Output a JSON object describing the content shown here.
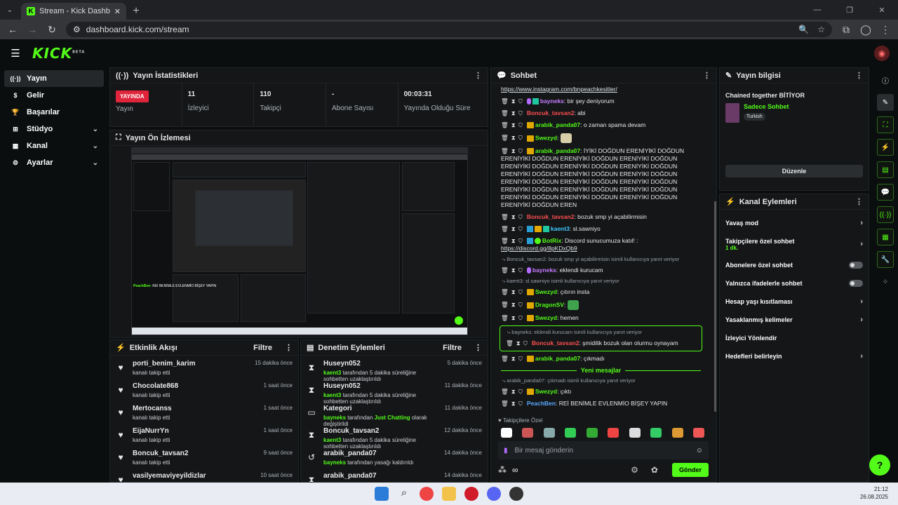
{
  "browser": {
    "tab_title": "Stream - Kick Dashboard",
    "url": "dashboard.kick.com/stream"
  },
  "brand": {
    "logo": "KICK",
    "beta": "BETA",
    "accent": "#53fc18"
  },
  "sidebar": {
    "items": [
      {
        "label": "Yayın",
        "icon": "broadcast-icon",
        "active": true
      },
      {
        "label": "Gelir",
        "icon": "dollar-icon"
      },
      {
        "label": "Başarılar",
        "icon": "trophy-icon"
      },
      {
        "label": "Stüdyo",
        "icon": "studio-icon",
        "chevron": true
      },
      {
        "label": "Kanal",
        "icon": "kanal-icon",
        "chevron": true
      },
      {
        "label": "Ayarlar",
        "icon": "gear-icon",
        "chevron": true
      }
    ]
  },
  "stats": {
    "title": "Yayın İstatistikleri",
    "live_badge": "YAYINDA",
    "live_label": "Yayın",
    "items": [
      {
        "value": "11",
        "label": "İzleyici"
      },
      {
        "value": "110",
        "label": "Takipçi"
      },
      {
        "value": "-",
        "label": "Abone Sayısı"
      },
      {
        "value": "00:03:31",
        "label": "Yayında Olduğu Süre"
      }
    ]
  },
  "preview": {
    "title": "Yayın Ön İzlemesi",
    "overlay_name": "PeachBen:",
    "overlay_text": "REİ BENİMLE EVLENMİO BİŞEY YAPIN"
  },
  "activity": {
    "title": "Etkinlik Akışı",
    "filter": "Filtre",
    "items": [
      {
        "name": "porti_benim_karim",
        "sub": "kanalı takip etti",
        "time": "15 dakika önce"
      },
      {
        "name": "Chocolate868",
        "sub": "kanalı takip etti",
        "time": "1 saat önce"
      },
      {
        "name": "Mertocanss",
        "sub": "kanalı takip etti",
        "time": "1 saat önce"
      },
      {
        "name": "EijaNurrYn",
        "sub": "kanalı takip etti",
        "time": "1 saat önce"
      },
      {
        "name": "Boncuk_tavsan2",
        "sub": "kanalı takip etti",
        "time": "9 saat önce"
      },
      {
        "name": "vasilyemaviyeyildizlar",
        "sub": "",
        "time": "10 saat önce"
      }
    ]
  },
  "mod": {
    "title": "Denetim Eylemleri",
    "filter": "Filtre",
    "items": [
      {
        "name": "Huseyn052",
        "actor": "kaent3",
        "rest": " tarafından 5 dakika süreliğine sohbetten uzaklaştırıldı",
        "time": "5 dakika önce",
        "icon": "hourglass-icon"
      },
      {
        "name": "Huseyn052",
        "actor": "kaent3",
        "rest": " tarafından 5 dakika süreliğine sohbetten uzaklaştırıldı",
        "time": "11 dakika önce",
        "icon": "hourglass-icon"
      },
      {
        "name": "Kategori",
        "actor": "bayneks",
        "mid": " tarafından ",
        "hl": "Just Chatting",
        "rest": " olarak değiştirildi",
        "time": "11 dakika önce",
        "icon": "category-icon"
      },
      {
        "name": "Boncuk_tavsan2",
        "actor": "kaent3",
        "rest": " tarafından 5 dakika süreliğine sohbetten uzaklaştırıldı",
        "time": "12 dakika önce",
        "icon": "hourglass-icon"
      },
      {
        "name": "arabik_panda07",
        "actor": "bayneks",
        "rest": " tarafından yasağı kaldırıldı",
        "time": "14 dakika önce",
        "icon": "undo-icon"
      },
      {
        "name": "arabik_panda07",
        "actor": "",
        "rest": "",
        "time": "14 dakika önce",
        "icon": "hourglass-icon"
      }
    ]
  },
  "chat": {
    "title": "Sohbet",
    "top_link": "https://www.instagram.com/bnpeachkesitler/",
    "messages": [
      {
        "user": "bayneks",
        "cls": "u-p",
        "badges": [
          "purple",
          "teal"
        ],
        "text": "bir şey deniyorum"
      },
      {
        "user": "Boncuk_tavsan2",
        "cls": "u-r",
        "badges": [],
        "text": "abi"
      },
      {
        "user": "arabik_panda07",
        "cls": "u-y",
        "badges": [
          "crown"
        ],
        "text": "o zaman spama devam"
      },
      {
        "user": "Swezyd",
        "cls": "u-y",
        "badges": [
          "crown"
        ],
        "text": "",
        "emote": "#d8cfa8"
      },
      {
        "user": "arabik_panda07",
        "cls": "u-y",
        "badges": [
          "crown"
        ],
        "text": "İYİKİ DOĞDUN ERENİYİKİ DOĞDUN ERENİYİKİ DOĞDUN ERENİYİKİ DOĞDUN ERENİYİKİ DOĞDUN ERENİYİKİ DOĞDUN ERENİYİKİ DOĞDUN ERENİYİKİ DOĞDUN ERENİYİKİ DOĞDUN ERENİYİKİ DOĞDUN ERENİYİKİ DOĞDUN ERENİYİKİ DOĞDUN ERENİYİKİ DOĞDUN ERENİYİKİ DOĞDUN ERENİYİKİ DOĞDUN ERENİYİKİ DOĞDUN ERENİYİKİ DOĞDUN ERENİYİKİ DOĞDUN ERENİYİKİ DOĞDUN ERENİYİKİ DOĞDUN ERENİYİKİ DOĞDUN EREN"
      },
      {
        "user": "Boncuk_tavsan2",
        "cls": "u-r",
        "badges": [],
        "text": "bozuk smp yi açabilirmisin"
      },
      {
        "user": "kaent3",
        "cls": "u-c",
        "badges": [
          "blue",
          "crown",
          "teal"
        ],
        "text": "sl.sawniyo"
      },
      {
        "user": "BotRix",
        "cls": "u-y",
        "badges": [
          "blue",
          "gcheck"
        ],
        "text": "Discord sunucumuza katıl! :",
        "link": "https://discord.gg/8pKDxQb9"
      },
      {
        "reply": "Boncuk_tavsan2: bozuk smp yi açabilirmisin isimli kullanıcıya yanıt veriyor",
        "user": "bayneks",
        "cls": "u-p",
        "badges": [
          "purple"
        ],
        "text": "eklendi kurucam"
      },
      {
        "reply": "kaent3: sl.sawniyo isimli kullanıcıya yanıt veriyor",
        "user": "Swezyd",
        "cls": "u-y",
        "badges": [
          "crown"
        ],
        "text": "çıtırın insta"
      },
      {
        "user": "DragonSV",
        "cls": "u-y",
        "badges": [
          "crown"
        ],
        "text": "",
        "emote": "#3fa34d"
      },
      {
        "user": "Swezyd",
        "cls": "u-y",
        "badges": [
          "crown"
        ],
        "text": "hemen"
      },
      {
        "highlight": true,
        "reply": "bayneks: eklendi kurucam isimli kullanıcıya yanıt veriyor",
        "user": "Boncuk_tavsan2",
        "cls": "u-r",
        "badges": [],
        "text": "şmidilik bozuk olan olurmu oynayam"
      },
      {
        "user": "arabik_panda07",
        "cls": "u-y",
        "badges": [
          "crown"
        ],
        "text": "çıkmadı"
      },
      {
        "newmsg": true
      },
      {
        "reply": "arabik_panda07: çıkmadı isimli kullanıcıya yanıt veriyor",
        "user": "Swezyd",
        "cls": "u-y",
        "badges": [
          "crown"
        ],
        "text": "çıktı"
      },
      {
        "user": "PeachBen",
        "cls": "u-bl",
        "badges": [],
        "text": "REİ BENİMLE EVLENMİO BİŞEY YAPIN"
      }
    ],
    "new_messages_label": "Yeni mesajlar",
    "emote_label": "Takipçilere Özel",
    "input_placeholder": "Bir mesaj gönderin",
    "send_label": "Gönder"
  },
  "info": {
    "title": "Yayın bilgisi",
    "stream_title": "Chained together BİTİYOR",
    "category": "Sadece Sohbet",
    "tag": "Turkish",
    "edit_label": "Düzenle"
  },
  "actions": {
    "title": "Kanal Eylemleri",
    "items": [
      {
        "label": "Yavaş mod",
        "type": "chevron"
      },
      {
        "label": "Takipçilere özel sohbet",
        "sub": "1 dk.",
        "type": "chevron"
      },
      {
        "label": "Abonelere özel sohbet",
        "type": "toggle"
      },
      {
        "label": "Yalnızca ifadelerle sohbet",
        "type": "toggle"
      },
      {
        "label": "Hesap yaşı kısıtlaması",
        "type": "chevron"
      },
      {
        "label": "Yasaklanmış kelimeler",
        "type": "chevron"
      },
      {
        "label": "İzleyici Yönlendir",
        "type": "none"
      },
      {
        "label": "Hedefleri belirleyin",
        "type": "chevron"
      }
    ]
  },
  "taskbar": {
    "time": "21:12",
    "date": "26.08.2025"
  }
}
